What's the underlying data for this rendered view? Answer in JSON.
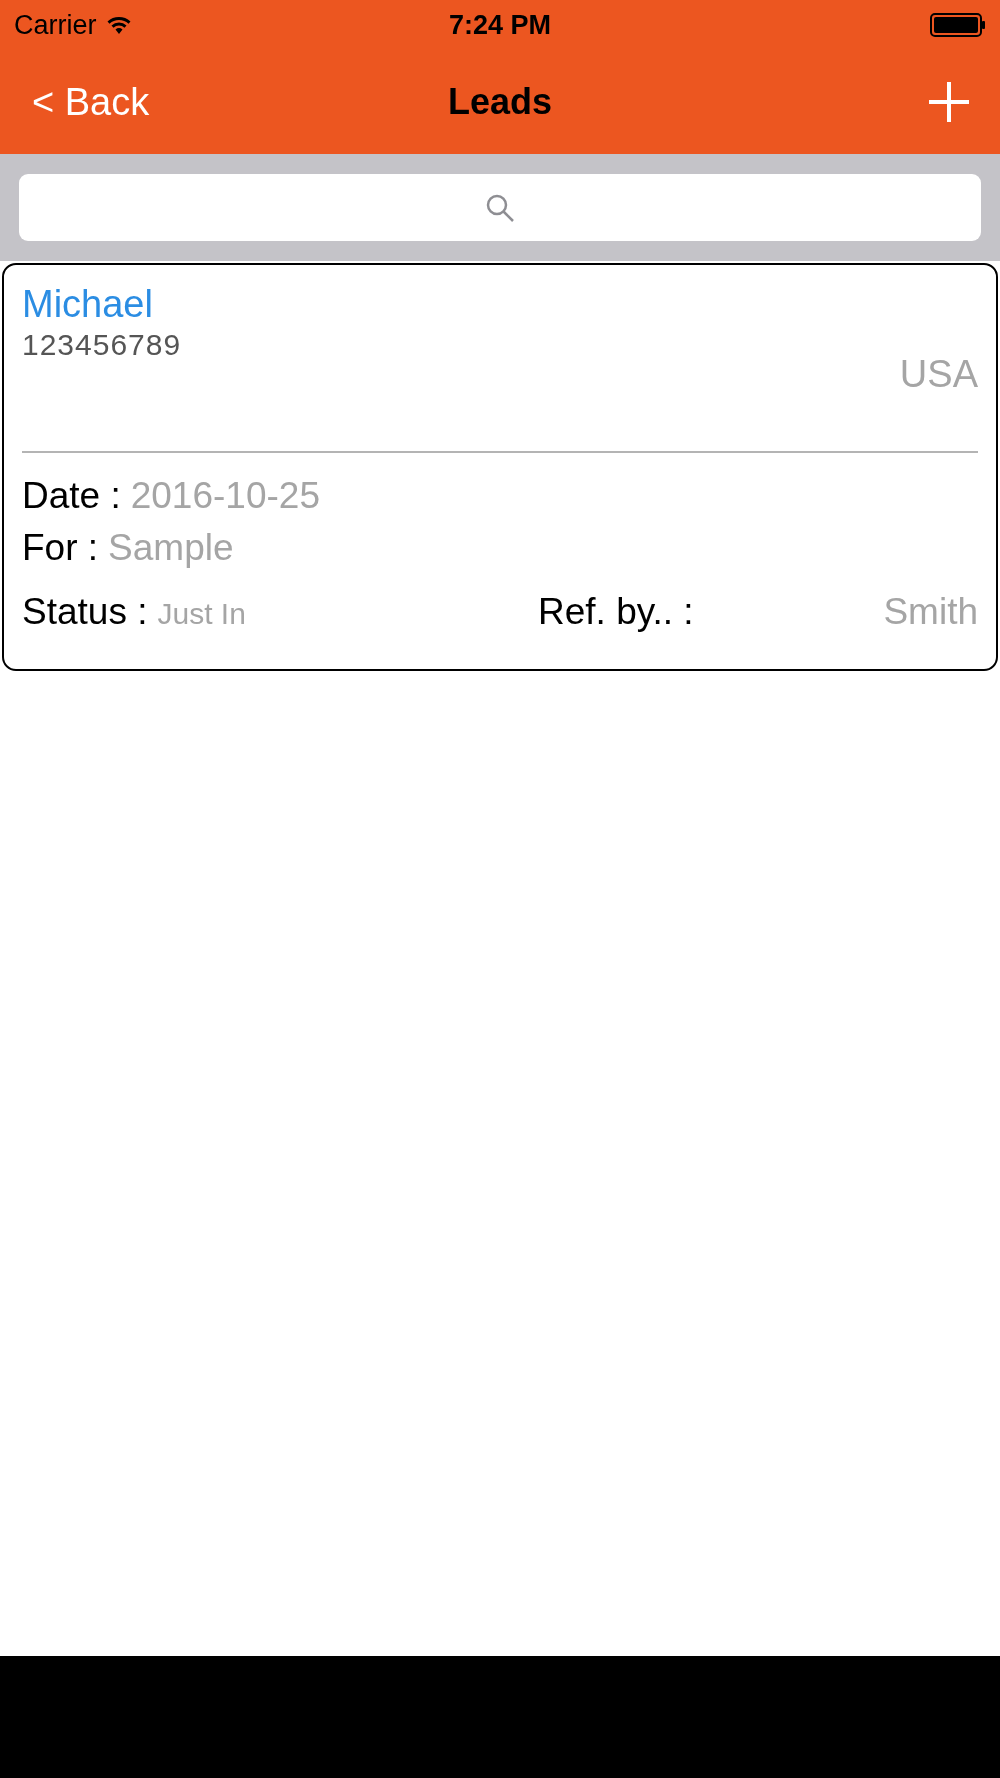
{
  "status_bar": {
    "carrier": "Carrier",
    "time": "7:24 PM"
  },
  "nav_bar": {
    "back": "< Back",
    "title": "Leads"
  },
  "leads": [
    {
      "name": "Michael",
      "phone": "123456789",
      "country": "USA",
      "date_label": "Date :",
      "date": "2016-10-25",
      "for_label": "For :",
      "for": "Sample",
      "status_label": "Status :",
      "status": "Just In",
      "ref_label": "Ref. by.. :",
      "ref": "Smith"
    }
  ]
}
